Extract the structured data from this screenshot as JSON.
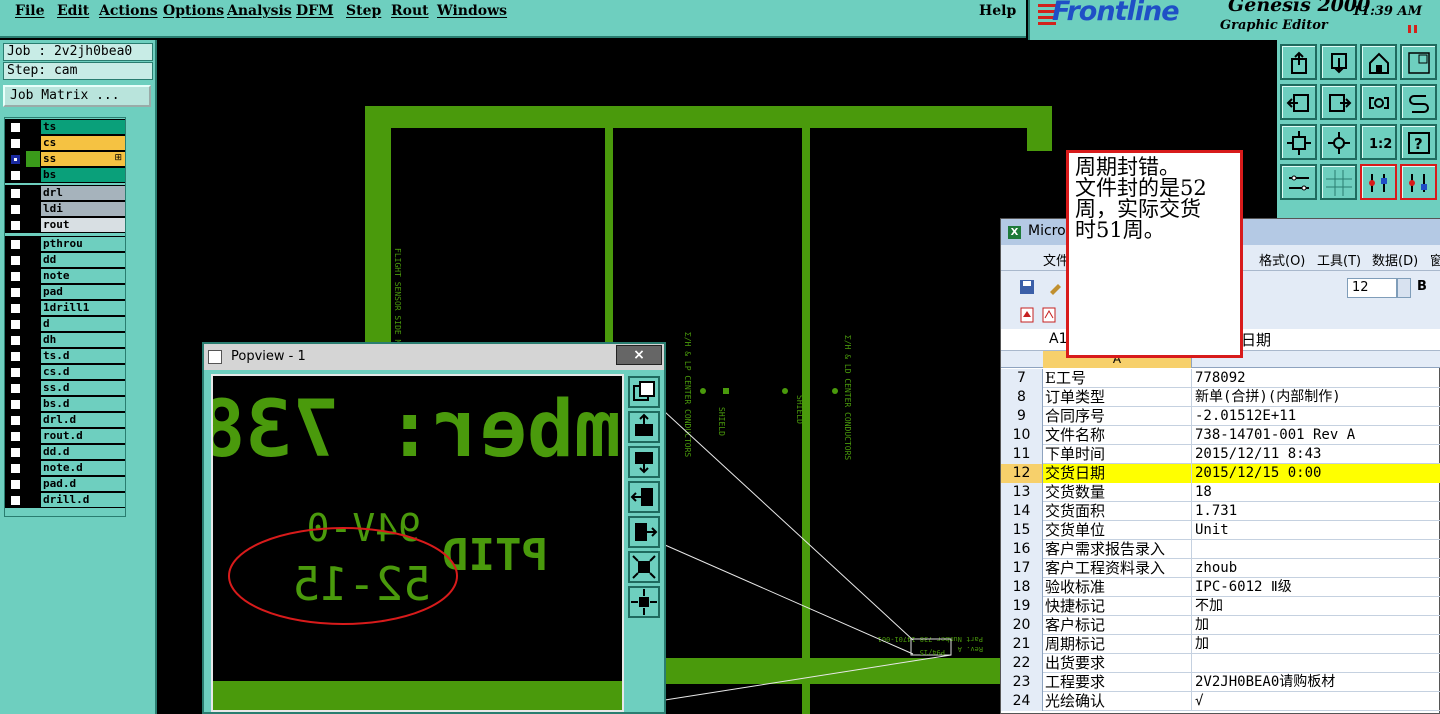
{
  "menu": {
    "items": [
      "File",
      "Edit",
      "Actions",
      "Options",
      "Analysis",
      "DFM",
      "Step",
      "Rout",
      "Windows"
    ],
    "help": "Help"
  },
  "brand": {
    "logo": "Frontline",
    "product": "Genesis 2000",
    "subtitle": "Graphic Editor",
    "clock": "11:39 AM"
  },
  "job": {
    "job_label": "Job : 2v2jh0bea0",
    "step_label": "Step: cam",
    "matrix_button": "Job Matrix ..."
  },
  "layers": [
    {
      "name": "ts",
      "color": "#0aa07a",
      "checked": false
    },
    {
      "name": "cs",
      "color": "#f5c242",
      "checked": false
    },
    {
      "name": "ss",
      "color": "#f5c242",
      "checked": true,
      "swatch": "#3a9a1a",
      "mark": "⊞"
    },
    {
      "name": "bs",
      "color": "#0aa07a",
      "checked": false
    },
    {
      "name": "drl",
      "color": "#a6b3bc",
      "checked": false
    },
    {
      "name": "ldi",
      "color": "#a6b3bc",
      "checked": false
    },
    {
      "name": "rout",
      "color": "#d8dfe3",
      "checked": false
    },
    {
      "name": "pthrou",
      "color": "#6ecfbf",
      "checked": false
    },
    {
      "name": "dd",
      "color": "#6ecfbf",
      "checked": false
    },
    {
      "name": "note",
      "color": "#6ecfbf",
      "checked": false
    },
    {
      "name": "pad",
      "color": "#6ecfbf",
      "checked": false
    },
    {
      "name": "1drill1",
      "color": "#6ecfbf",
      "checked": false
    },
    {
      "name": "d",
      "color": "#6ecfbf",
      "checked": false
    },
    {
      "name": "dh",
      "color": "#6ecfbf",
      "checked": false
    },
    {
      "name": "ts.d",
      "color": "#6ecfbf",
      "checked": false
    },
    {
      "name": "cs.d",
      "color": "#6ecfbf",
      "checked": false
    },
    {
      "name": "ss.d",
      "color": "#6ecfbf",
      "checked": false
    },
    {
      "name": "bs.d",
      "color": "#6ecfbf",
      "checked": false
    },
    {
      "name": "drl.d",
      "color": "#6ecfbf",
      "checked": false
    },
    {
      "name": "rout.d",
      "color": "#6ecfbf",
      "checked": false
    },
    {
      "name": "dd.d",
      "color": "#6ecfbf",
      "checked": false
    },
    {
      "name": "note.d",
      "color": "#6ecfbf",
      "checked": false
    },
    {
      "name": "pad.d",
      "color": "#6ecfbf",
      "checked": false
    },
    {
      "name": "drill.d",
      "color": "#6ecfbf",
      "checked": false
    }
  ],
  "popview": {
    "title": "Popview - 1",
    "close": "×",
    "text_big": "mber: 738",
    "text_ul": "94V-0",
    "text_ptid": "PTID",
    "text_date": "52-15"
  },
  "toolbox": {
    "ratio_label": "1:2",
    "help_label": "?"
  },
  "annotation": {
    "lines": [
      "周期封错。",
      "文件封的是52",
      "周，实际交货",
      "时51周。"
    ]
  },
  "excel": {
    "title": "Micros",
    "menu": [
      "文件",
      "格式(O)",
      "工具(T)",
      "数据(D)",
      "窗"
    ],
    "font_size": "12",
    "bold": "B",
    "name_box": "A1",
    "formula": "日期",
    "column_a": "A",
    "rows": [
      {
        "n": "7",
        "a": "E工号",
        "b": "778092"
      },
      {
        "n": "8",
        "a": "订单类型",
        "b": "新单(合拼)(内部制作)"
      },
      {
        "n": "9",
        "a": "合同序号",
        "b": "-2.01512E+11"
      },
      {
        "n": "10",
        "a": "文件名称",
        "b": "738-14701-001 Rev A"
      },
      {
        "n": "11",
        "a": "下单时间",
        "b": "2015/12/11 8:43"
      },
      {
        "n": "12",
        "a": "交货日期",
        "b": "2015/12/15 0:00",
        "highlight": true
      },
      {
        "n": "13",
        "a": "交货数量",
        "b": "18"
      },
      {
        "n": "14",
        "a": "交货面积",
        "b": "1.731"
      },
      {
        "n": "15",
        "a": "交货单位",
        "b": "Unit"
      },
      {
        "n": "16",
        "a": "客户需求报告录入",
        "b": ""
      },
      {
        "n": "17",
        "a": "客户工程资料录入",
        "b": "zhoub"
      },
      {
        "n": "18",
        "a": "验收标准",
        "b": "IPC-6012 Ⅱ级"
      },
      {
        "n": "19",
        "a": "快捷标记",
        "b": "不加"
      },
      {
        "n": "20",
        "a": "客户标记",
        "b": "加"
      },
      {
        "n": "21",
        "a": "周期标记",
        "b": "加"
      },
      {
        "n": "22",
        "a": "出货要求",
        "b": ""
      },
      {
        "n": "23",
        "a": "工程要求",
        "b": "2V2JH0BEA0请购板材"
      },
      {
        "n": "24",
        "a": "光绘确认",
        "b": "√"
      }
    ]
  },
  "pcb": {
    "text_left": "FLIGHT SENSOR SIDE MOUNT THIS END DOWN",
    "text_mid1": "Σ/H & LP CENTER CONDUCTORS",
    "text_mid2": "Σ/H & LD CENTER CONDUCTORS",
    "text_shield1": "SHIELD",
    "text_shield2": "SHIELD",
    "text_partno": "Part Number 738-14701-001",
    "text_rev": "Rev. A",
    "text_date": "P94/15"
  },
  "colors": {
    "panel": "#6ecfbf",
    "pcb_green": "#4a9a0c",
    "highlight": "#ffff00",
    "annotation_border": "#d81b1b"
  }
}
